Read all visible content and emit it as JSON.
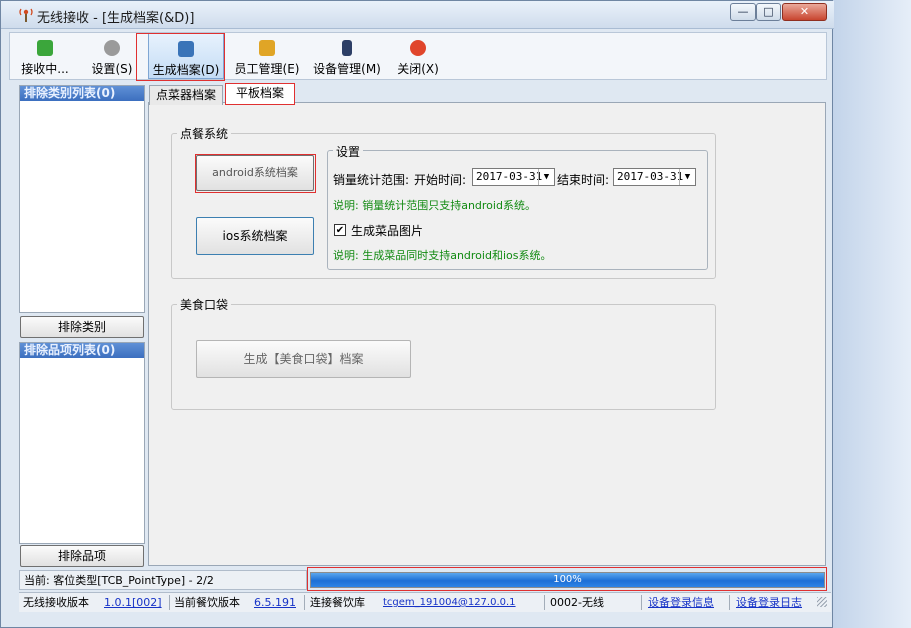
{
  "window": {
    "title": "无线接收 - [生成档案(&D)]",
    "controls": {
      "minimize": "—",
      "maximize": "□",
      "close": "✕"
    }
  },
  "toolbar": {
    "items": [
      {
        "label": "接收中...",
        "icon": "receive-icon",
        "color": "#3ba63b"
      },
      {
        "label": "设置(S)",
        "icon": "gear-icon",
        "color": "#8a8a8a"
      },
      {
        "label": "生成档案(D)",
        "icon": "archive-icon",
        "color": "#3a74b8"
      },
      {
        "label": "员工管理(E)",
        "icon": "employee-icon",
        "color": "#e0a526"
      },
      {
        "label": "设备管理(M)",
        "icon": "device-icon",
        "color": "#2d3f66"
      },
      {
        "label": "关闭(X)",
        "icon": "close-icon",
        "color": "#e0452b"
      }
    ]
  },
  "sidebar": {
    "category_header": "排除类别列表(0)",
    "category_button": "排除类别",
    "item_header": "排除品项列表(0)",
    "item_button": "排除品项"
  },
  "tabs": [
    {
      "label": "点菜器档案"
    },
    {
      "label": "平板档案"
    }
  ],
  "ordering_system": {
    "group_label": "点餐系统",
    "android_button": "android系统档案",
    "ios_button": "ios系统档案",
    "settings": {
      "group_label": "设置",
      "range_label": "销量统计范围:",
      "start_label": "开始时间:",
      "start_value": "2017-03-31",
      "end_label": "结束时间:",
      "end_value": "2017-03-31",
      "note1": "说明: 销量统计范围只支持android系统。",
      "checkbox_label": "生成菜品图片",
      "checkbox_mark": "✔",
      "note2": "说明: 生成菜品同时支持android和ios系统。"
    }
  },
  "food_pocket": {
    "group_label": "美食口袋",
    "button": "生成【美食口袋】档案"
  },
  "status": {
    "current": "当前: 客位类型[TCB_PointType]  -  2/2",
    "progress_text": "100%",
    "progress": 1.0,
    "receive_version_label": "无线接收版本",
    "receive_version": "1.0.1[002]",
    "catering_version_label": "当前餐饮版本",
    "catering_version": "6.5.191",
    "db_label": "连接餐饮库",
    "db_value": "tcgem_191004@127.0.0.1",
    "device_code": "0002-无线",
    "login_info": "设备登录信息",
    "login_log": "设备登录日志"
  }
}
